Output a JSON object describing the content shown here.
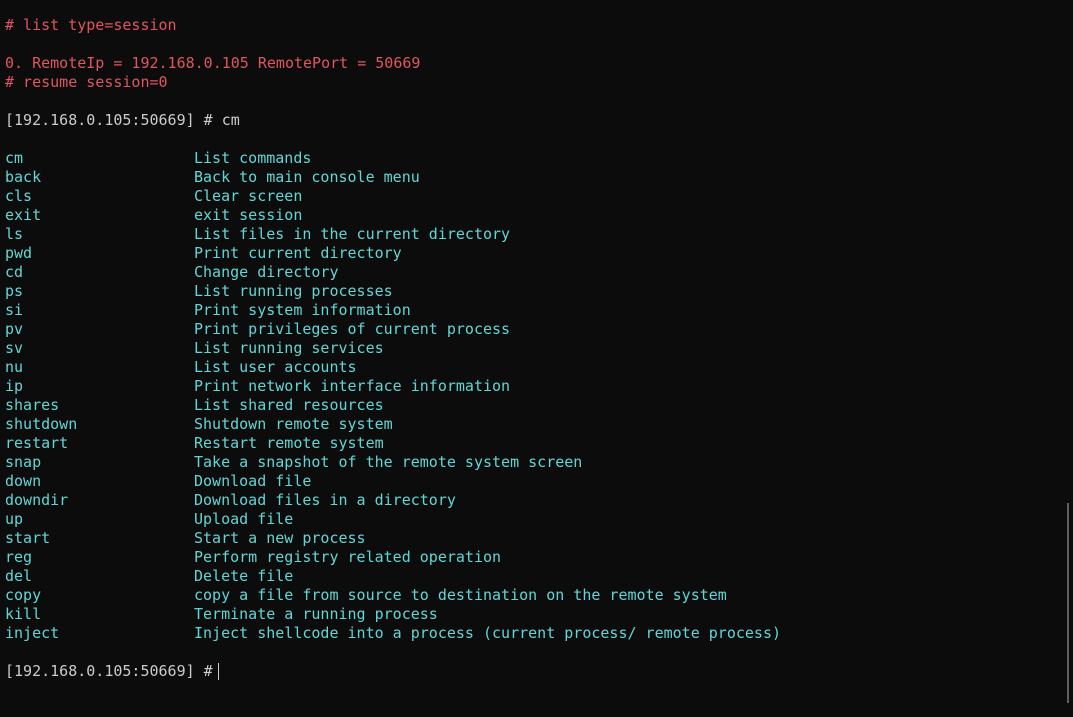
{
  "session": {
    "list_cmd": "# list type=session",
    "entry": "0. RemoteIp = 192.168.0.105 RemotePort = 50669",
    "resume_cmd": "# resume session=0"
  },
  "prompt": {
    "text": "[192.168.0.105:50669] #",
    "first_command": "cm"
  },
  "commands": [
    {
      "name": "cm",
      "desc": "List commands"
    },
    {
      "name": "back",
      "desc": "Back to main console menu"
    },
    {
      "name": "cls",
      "desc": "Clear screen"
    },
    {
      "name": "exit",
      "desc": "exit session"
    },
    {
      "name": "ls",
      "desc": "List files in the current directory"
    },
    {
      "name": "pwd",
      "desc": "Print current directory"
    },
    {
      "name": "cd",
      "desc": "Change directory"
    },
    {
      "name": "ps",
      "desc": "List running processes"
    },
    {
      "name": "si",
      "desc": "Print system information"
    },
    {
      "name": "pv",
      "desc": "Print privileges of current process"
    },
    {
      "name": "sv",
      "desc": "List running services"
    },
    {
      "name": "nu",
      "desc": "List user accounts"
    },
    {
      "name": "ip",
      "desc": "Print network interface information"
    },
    {
      "name": "shares",
      "desc": "List shared resources"
    },
    {
      "name": "shutdown",
      "desc": "Shutdown remote system"
    },
    {
      "name": "restart",
      "desc": "Restart remote system"
    },
    {
      "name": "snap",
      "desc": "Take a snapshot of the remote system screen"
    },
    {
      "name": "down",
      "desc": "Download file"
    },
    {
      "name": "downdir",
      "desc": "Download files in a directory"
    },
    {
      "name": "up",
      "desc": "Upload file"
    },
    {
      "name": "start",
      "desc": "Start a new process"
    },
    {
      "name": "reg",
      "desc": "Perform registry related operation"
    },
    {
      "name": "del",
      "desc": "Delete file"
    },
    {
      "name": "copy",
      "desc": "copy a file from source to destination on the remote system"
    },
    {
      "name": "kill",
      "desc": "Terminate a running process"
    },
    {
      "name": "inject",
      "desc": "Inject shellcode into a process (current process/ remote process)"
    }
  ],
  "colors": {
    "background": "#0c0c0c",
    "red": "#e05561",
    "cyan": "#61d6d6",
    "prompt": "#cccccc"
  }
}
